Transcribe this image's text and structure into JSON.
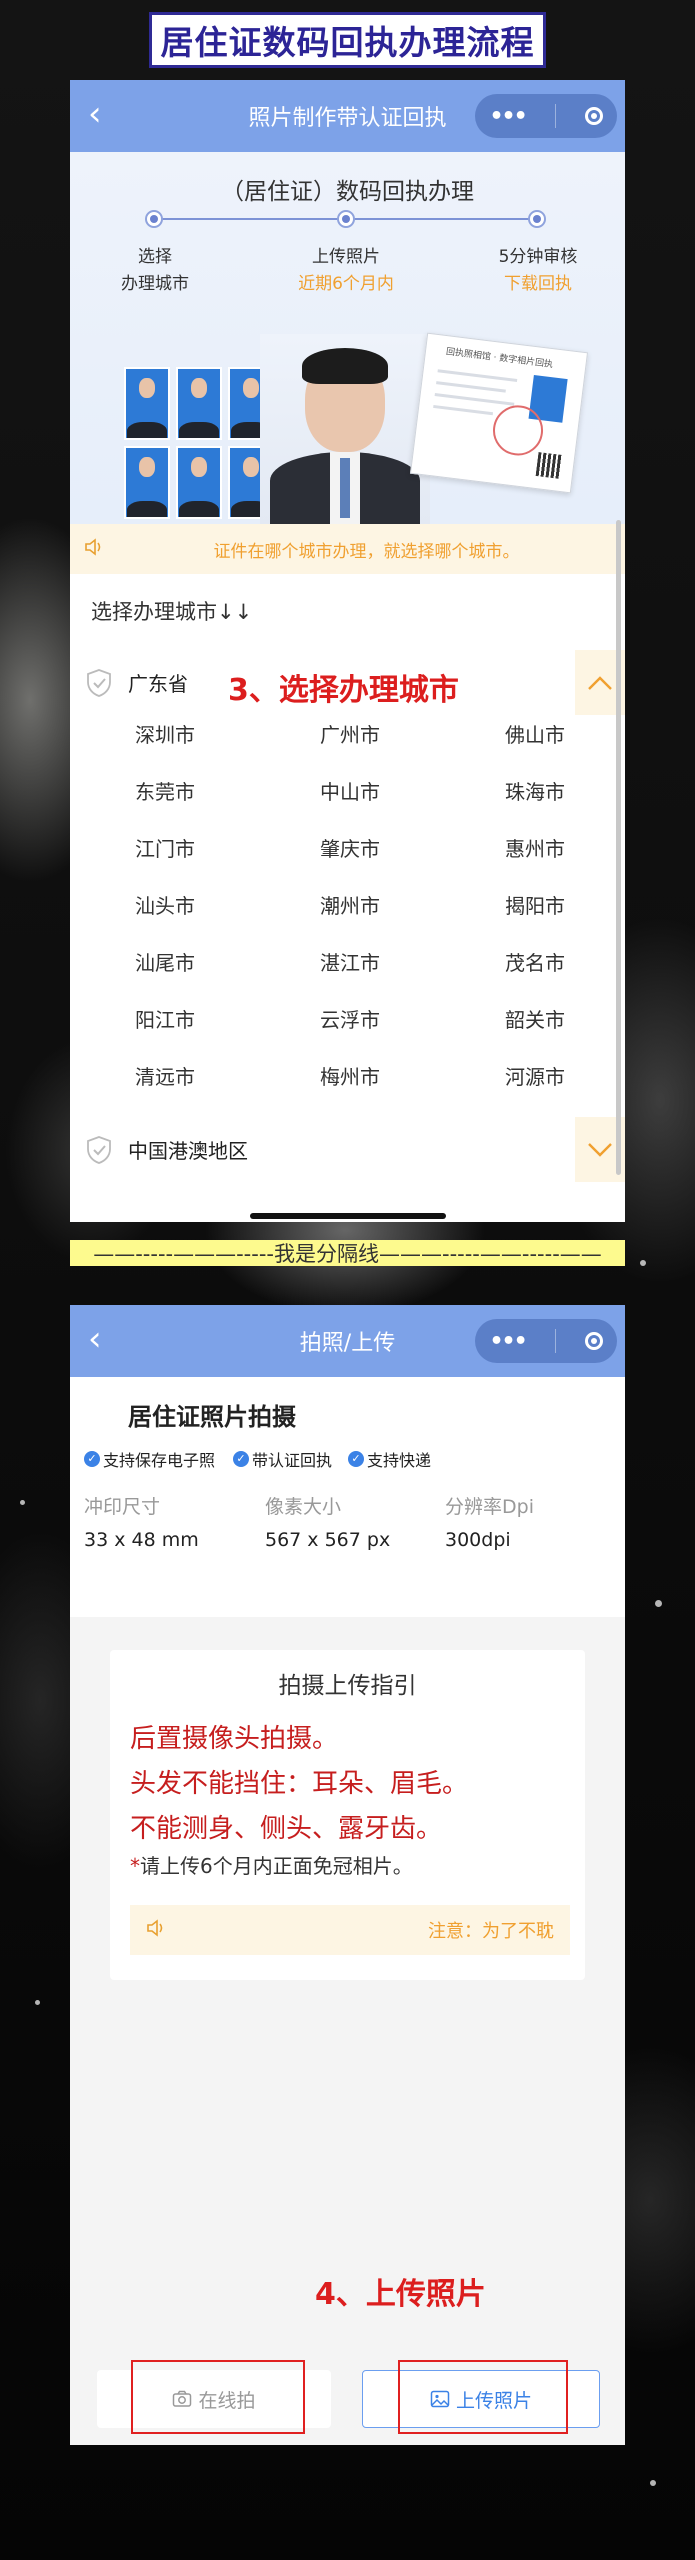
{
  "banner_title": "居住证数码回执办理流程",
  "screen1": {
    "nav_title": "照片制作带认证回执",
    "back_icon": "‹",
    "capsule_dots": "•••",
    "hero_title": "（居住证）数码回执办理",
    "steps": [
      {
        "line1": "选择",
        "line2": "办理城市"
      },
      {
        "line1": "上传照片",
        "line2": "近期6个月内"
      },
      {
        "line1": "5分钟审核",
        "line2": "下载回执"
      }
    ],
    "receipt_title": "回执照相馆 · 数字相片回执",
    "notice": "证件在哪个城市办理，就选择哪个城市。",
    "select_label": "选择办理城市↓↓",
    "province_1": "广东省",
    "province_2": "中国港澳地区",
    "cities": [
      [
        "深圳市",
        "广州市",
        "佛山市"
      ],
      [
        "东莞市",
        "中山市",
        "珠海市"
      ],
      [
        "江门市",
        "肇庆市",
        "惠州市"
      ],
      [
        "汕头市",
        "潮州市",
        "揭阳市"
      ],
      [
        "汕尾市",
        "湛江市",
        "茂名市"
      ],
      [
        "阳江市",
        "云浮市",
        "韶关市"
      ],
      [
        "清远市",
        "梅州市",
        "河源市"
      ]
    ],
    "annotation": "3、选择办理城市"
  },
  "divider_text": "——-----———-----我是分隔线———-----——-----——",
  "screen2": {
    "nav_title": "拍照/上传",
    "back_icon": "‹",
    "capsule_dots": "•••",
    "card_title": "居住证照片拍摄",
    "badges": [
      "支持保存电子照",
      "带认证回执",
      "支持快递"
    ],
    "specs": [
      {
        "label": "冲印尺寸",
        "value": "33 x 48 mm"
      },
      {
        "label": "像素大小",
        "value": "567 x 567 px"
      },
      {
        "label": "分辨率Dpi",
        "value": "300dpi"
      }
    ],
    "guide_title": "拍摄上传指引",
    "guide_lines": [
      "后置摄像头拍摄。",
      "头发不能挡住：耳朵、眉毛。",
      "不能测身、侧头、露牙齿。"
    ],
    "guide_note_star": "*",
    "guide_note": "请上传6个月内正面免冠相片。",
    "guide_notice": "注意：为了不耽",
    "annotation": "4、上传照片",
    "btn_online": "在线拍",
    "btn_upload": "上传照片"
  },
  "colors": {
    "nav_blue": "#7da2e8",
    "accent_orange": "#f0a030",
    "annotation_red": "#dc1e1e",
    "banner_border": "#2f2a95"
  }
}
